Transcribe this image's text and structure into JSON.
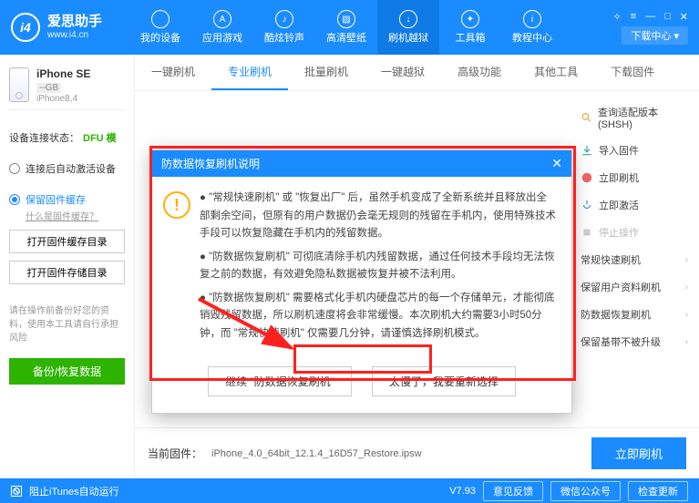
{
  "logo": {
    "glyph": "i4",
    "title": "爱思助手",
    "url": "www.i4.cn"
  },
  "topnav": [
    {
      "label": "我的设备"
    },
    {
      "label": "应用游戏"
    },
    {
      "label": "酷炫铃声"
    },
    {
      "label": "高清壁纸"
    },
    {
      "label": "刷机越狱"
    },
    {
      "label": "工具箱"
    },
    {
      "label": "教程中心"
    }
  ],
  "download_center": "下载中心 ▾",
  "win": {
    "skin": "✧",
    "menu": "≡",
    "min": "—",
    "max": "□",
    "close": "✕"
  },
  "device": {
    "name": "iPhone SE",
    "capacity": "--GB",
    "model": "iPhone8,4"
  },
  "conn": {
    "label": "设备连接状态：",
    "mode": "DFU 模"
  },
  "radios": {
    "auto_activate": "连接后自动激活设备",
    "keep_firmware": "保留固件缓存",
    "what_is": "什么是固件缓存？"
  },
  "sb_buttons": {
    "open_cache": "打开固件缓存目录",
    "open_store": "打开固件存储目录"
  },
  "sb_note": "请在操作前备份好您的资料，使用本工具请自行承担风险",
  "backup_btn": "备份/恢复数据",
  "subtabs": [
    "一键刷机",
    "专业刷机",
    "批量刷机",
    "一键越狱",
    "高级功能",
    "其他工具",
    "下载固件"
  ],
  "right_items": [
    {
      "label": "查询适配版本 (SHSH)"
    },
    {
      "label": "导入固件"
    },
    {
      "label": "立即刷机"
    },
    {
      "label": "立即激活"
    },
    {
      "label": "停止操作",
      "disabled": true
    },
    {
      "label": "常规快速刷机"
    },
    {
      "label": "保留用户资料刷机"
    },
    {
      "label": "防数据恢复刷机"
    },
    {
      "label": "保留基带不被升级"
    }
  ],
  "footer": {
    "label": "当前固件：",
    "path": "iPhone_4.0_64bit_12.1.4_16D57_Restore.ipsw",
    "flash": "立即刷机"
  },
  "statusbar": {
    "block_itunes": "阻止iTunes自动运行",
    "version": "V7.93",
    "feedback": "意见反馈",
    "wechat": "微信公众号",
    "update": "检查更新"
  },
  "dialog": {
    "title": "防数据恢复刷机说明",
    "p1": "●  \"常规快速刷机\" 或 \"恢复出厂\" 后，虽然手机变成了全新系统并且释放出全部剩余空间，但原有的用户数据仍会毫无规则的残留在手机内，使用特殊技术手段可以恢复隐藏在手机内的残留数据。",
    "p2": "●  \"防数据恢复刷机\" 可彻底清除手机内残留数据，通过任何技术手段均无法恢复之前的数据，有效避免隐私数据被恢复并被不法利用。",
    "p3": "●  \"防数据恢复刷机\" 需要格式化手机内硬盘芯片的每一个存储单元，才能彻底销毁残留数据，所以刷机速度将会非常缓慢。本次刷机大约需要3小时50分钟，而 \"常规快速刷机\" 仅需要几分钟，请谨慎选择刷机模式。",
    "btn_continue": "继续 \"防数据恢复刷机\"",
    "btn_back": "太慢了，我要重新选择"
  }
}
